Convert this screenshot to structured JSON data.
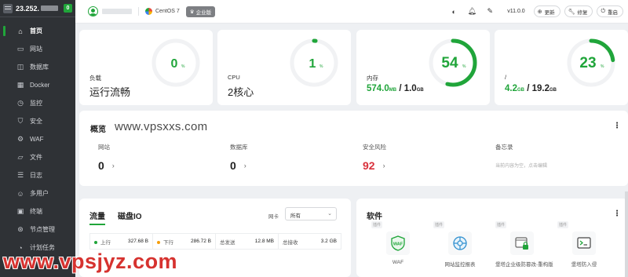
{
  "sidebar": {
    "server_ip": "23.252.",
    "notification_count": "0",
    "items": [
      {
        "label": "首页",
        "icon": "home-icon",
        "glyph": "⌂",
        "active": true
      },
      {
        "label": "网站",
        "icon": "website-icon",
        "glyph": "▭"
      },
      {
        "label": "数据库",
        "icon": "database-icon",
        "glyph": "◫"
      },
      {
        "label": "Docker",
        "icon": "docker-icon",
        "glyph": "▦"
      },
      {
        "label": "监控",
        "icon": "monitor-icon",
        "glyph": "◷"
      },
      {
        "label": "安全",
        "icon": "shield-icon",
        "glyph": "⛉"
      },
      {
        "label": "WAF",
        "icon": "waf-icon",
        "glyph": "⚙"
      },
      {
        "label": "文件",
        "icon": "folder-icon",
        "glyph": "▱"
      },
      {
        "label": "日志",
        "icon": "log-icon",
        "glyph": "☰"
      },
      {
        "label": "多用户",
        "icon": "users-icon",
        "glyph": "☺"
      },
      {
        "label": "终端",
        "icon": "terminal-icon",
        "glyph": "▣"
      },
      {
        "label": "节点管理",
        "icon": "node-icon",
        "glyph": "⊛"
      },
      {
        "label": "计划任务",
        "icon": "clock-icon",
        "glyph": "◔"
      }
    ]
  },
  "topbar": {
    "os_name": "CentOS 7",
    "edition_badge": "企业版",
    "version": "v11.0.0",
    "update_label": "更新",
    "repair_label": "修复",
    "restart_label": "重启"
  },
  "stats": {
    "load": {
      "label": "负载",
      "percent": "0",
      "status": "运行流畅",
      "value": 0
    },
    "cpu": {
      "label": "CPU",
      "percent": "1",
      "cores": "2核心",
      "value": 1
    },
    "memory": {
      "label": "内存",
      "percent": "54",
      "used": "574.0",
      "used_unit": "MB",
      "separator": " / ",
      "total": "1.0",
      "total_unit": "GB",
      "value": 54
    },
    "disk": {
      "label": "/",
      "percent": "23",
      "used": "4.2",
      "used_unit": "GB",
      "separator": " / ",
      "total": "19.2",
      "total_unit": "GB",
      "value": 23
    },
    "percent_sign": "%"
  },
  "overview": {
    "title": "概览",
    "watermark": "www.vpsxxs.com",
    "items": [
      {
        "label": "网站",
        "value": "0"
      },
      {
        "label": "数据库",
        "value": "0"
      },
      {
        "label": "安全风险",
        "value": "92"
      },
      {
        "label": "备忘录",
        "placeholder": "当前内容为空，点击编辑"
      }
    ]
  },
  "traffic": {
    "tab_traffic": "流量",
    "tab_disk_io": "磁盘IO",
    "nic_label": "网卡",
    "nic_value": "所有",
    "cells": [
      {
        "label": "上行",
        "value": "327.68 B",
        "dot": "#20a53a"
      },
      {
        "label": "下行",
        "value": "286.72 B",
        "dot": "#f59e0b"
      },
      {
        "label": "总发送",
        "value": "12.8 MB"
      },
      {
        "label": "总接收",
        "value": "3.2 GB"
      }
    ]
  },
  "software": {
    "title": "软件",
    "tag": "插件",
    "items": [
      {
        "name": "WAF",
        "icon": "waf-shield-icon"
      },
      {
        "name": "网站监控报表",
        "icon": "website-monitor-icon"
      },
      {
        "name": "堡塔企业级防篡改-重构版",
        "icon": "tamper-proof-icon"
      },
      {
        "name": "堡塔防入侵",
        "icon": "intrusion-prevention-icon"
      }
    ]
  },
  "bottom_watermark": "www.vpsjyz.com",
  "colors": {
    "accent": "#20a53a",
    "danger": "#d9313c",
    "sidebar_bg": "#2f3236"
  }
}
